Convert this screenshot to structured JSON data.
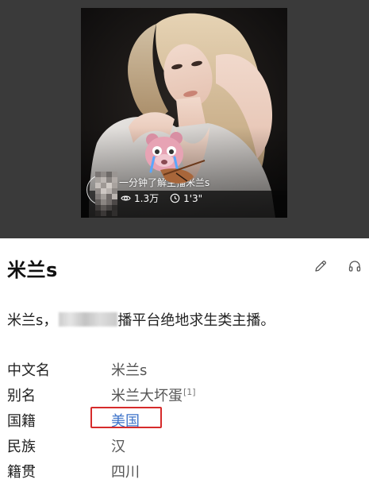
{
  "video": {
    "title": "一分钟了解主播米兰s",
    "views": "1.3万",
    "duration": "1'3\""
  },
  "entry": {
    "title": "米兰s",
    "summary_prefix": "米兰s，",
    "summary_suffix": "播平台绝地求生类主播。"
  },
  "info": [
    {
      "label": "中文名",
      "value": "米兰s"
    },
    {
      "label": "别名",
      "value": "米兰大坏蛋",
      "cite": "[1]"
    },
    {
      "label": "国籍",
      "value": "美国"
    },
    {
      "label": "民族",
      "value": "汉"
    },
    {
      "label": "籍贯",
      "value": "四川"
    }
  ],
  "icons": {
    "edit": "pencil-icon",
    "listen": "headphones-icon",
    "views": "eye-icon",
    "duration": "clock-icon"
  },
  "colors": {
    "link": "#3d73c9",
    "highlight": "#d62b2b",
    "media_bg": "#3a3a3a"
  }
}
